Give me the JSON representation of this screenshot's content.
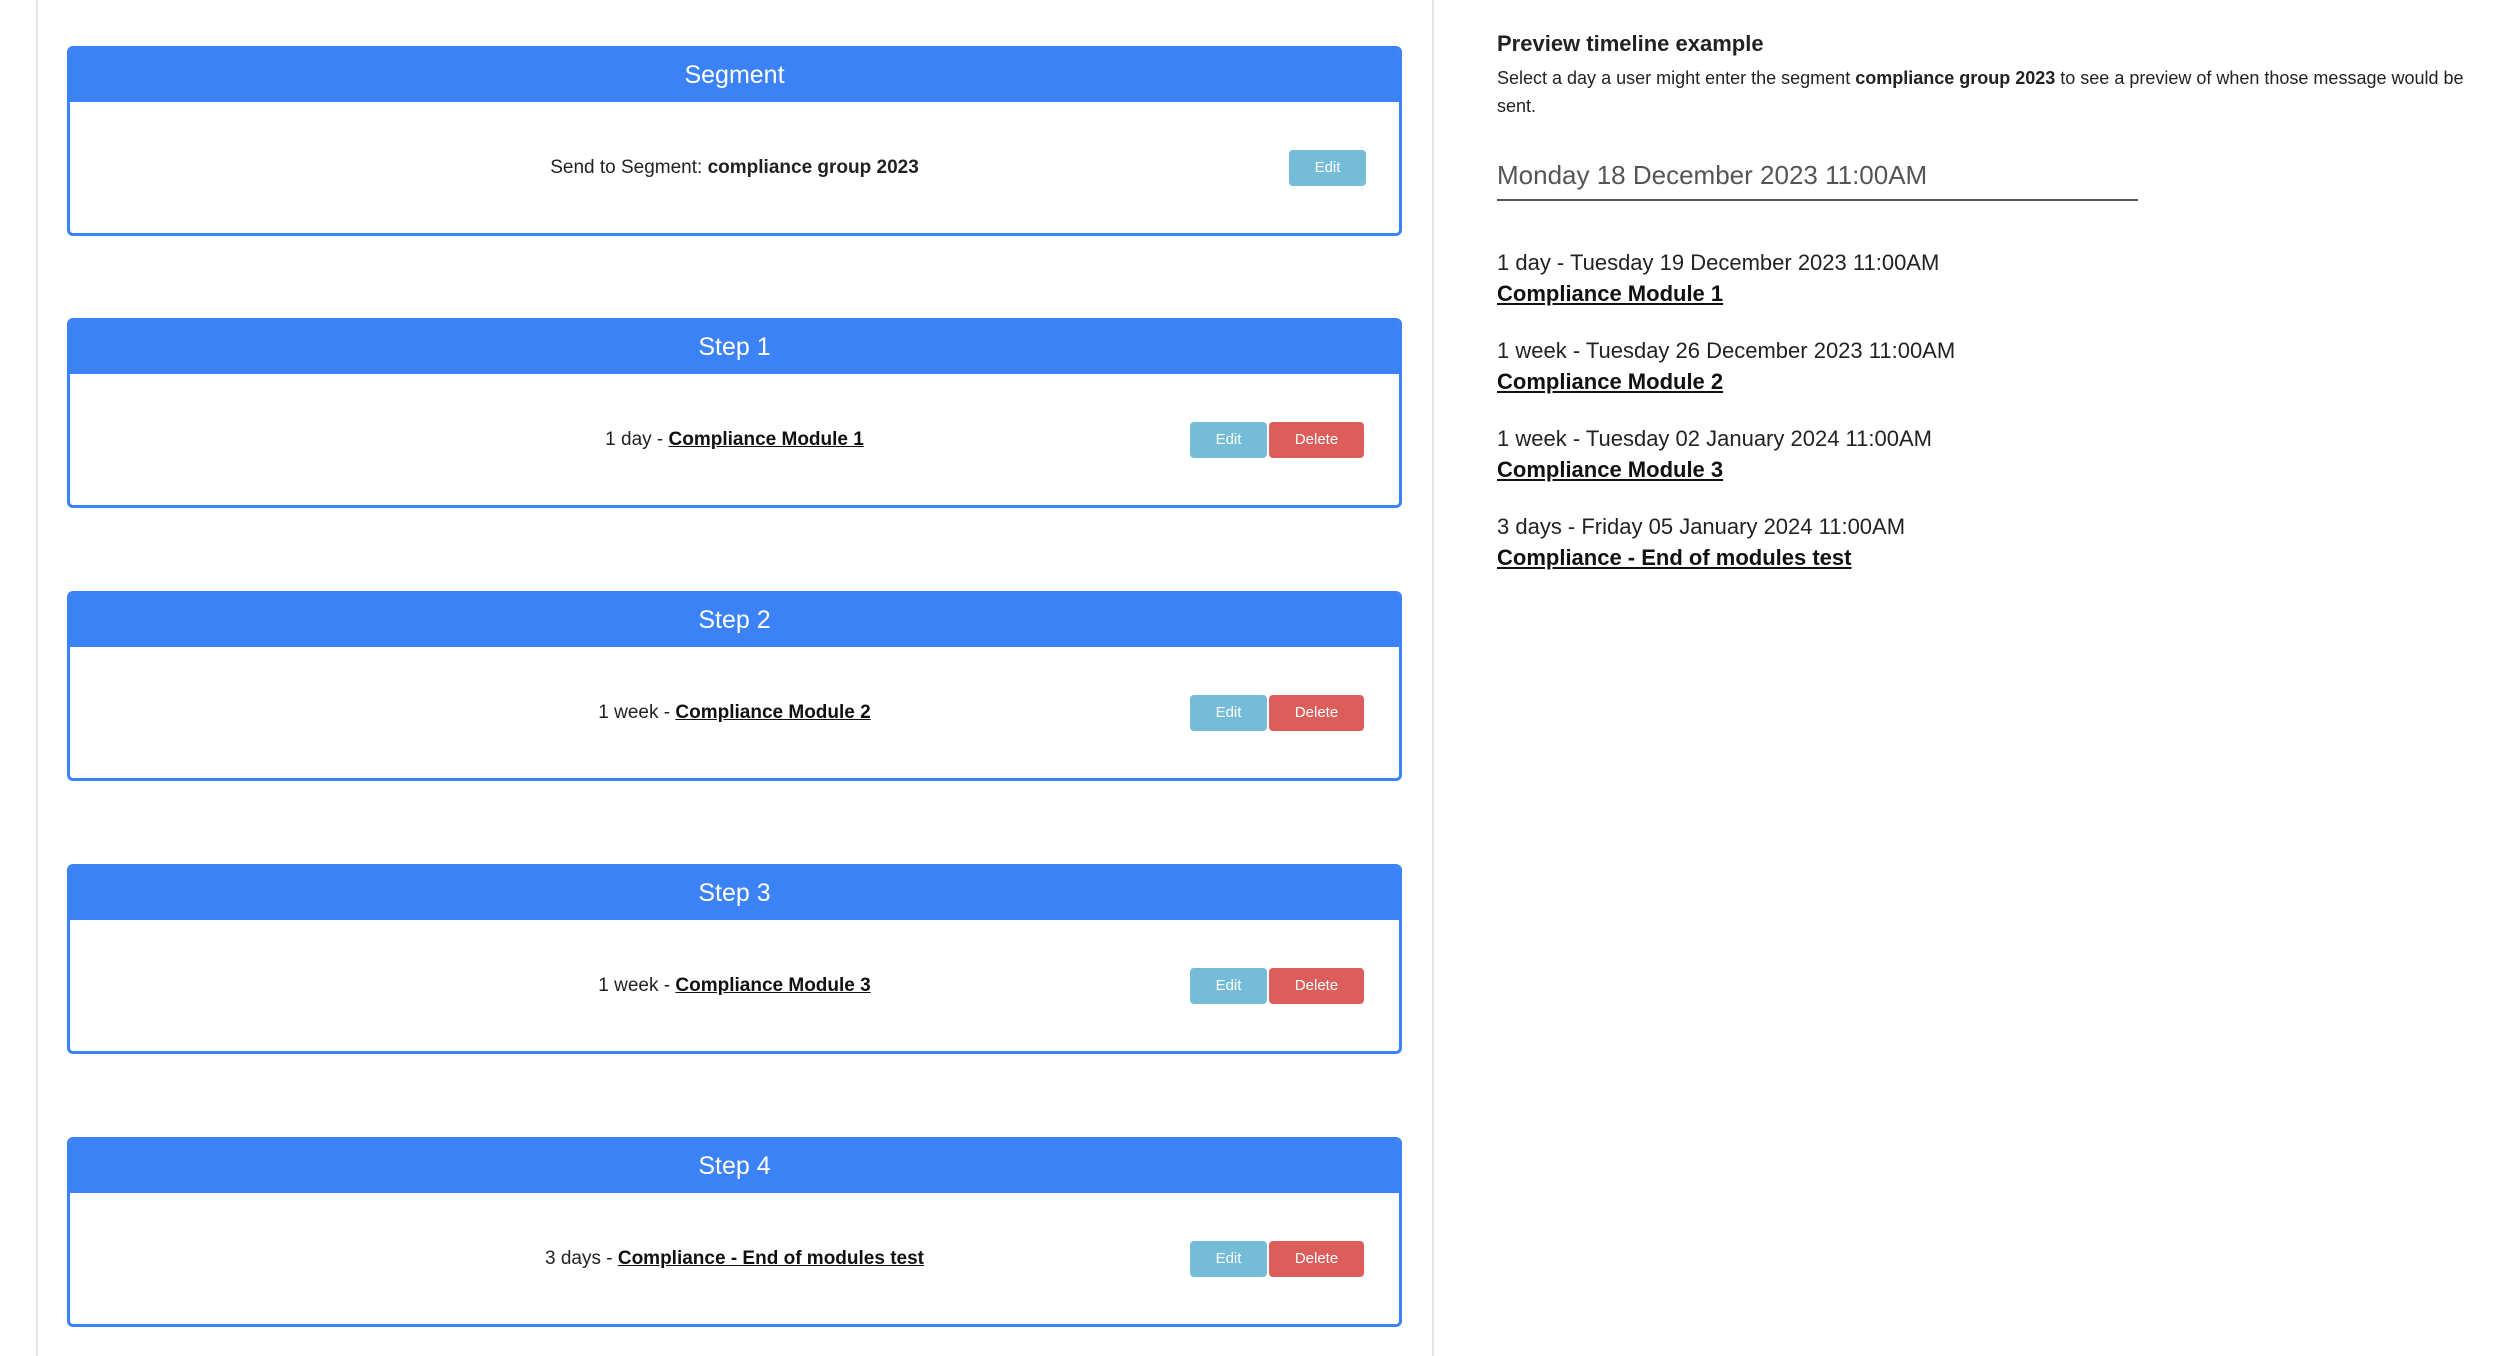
{
  "segment_card": {
    "header": "Segment",
    "text_prefix": "Send to Segment: ",
    "segment_name": "compliance group 2023",
    "edit_label": "Edit"
  },
  "steps": [
    {
      "header": "Step 1",
      "delay": "1 day - ",
      "module": "Compliance Module 1",
      "edit_label": "Edit",
      "delete_label": "Delete"
    },
    {
      "header": "Step 2",
      "delay": "1 week - ",
      "module": "Compliance Module 2",
      "edit_label": "Edit",
      "delete_label": "Delete"
    },
    {
      "header": "Step 3",
      "delay": "1 week - ",
      "module": "Compliance Module 3",
      "edit_label": "Edit",
      "delete_label": "Delete"
    },
    {
      "header": "Step 4",
      "delay": "3 days - ",
      "module": "Compliance - End of modules test",
      "edit_label": "Edit",
      "delete_label": "Delete"
    }
  ],
  "preview": {
    "title": "Preview timeline example",
    "desc_before": "Select a day a user might enter the segment ",
    "desc_segment": "compliance group 2023",
    "desc_after": " to see a preview of when those message would be sent.",
    "selected_date": "Monday 18 December 2023 11:00AM",
    "timeline": [
      {
        "when": "1 day - Tuesday 19 December 2023 11:00AM",
        "module": "Compliance Module 1"
      },
      {
        "when": "1 week - Tuesday 26 December 2023 11:00AM",
        "module": "Compliance Module 2"
      },
      {
        "when": "1 week - Tuesday 02 January 2024 11:00AM",
        "module": "Compliance Module 3"
      },
      {
        "when": "3 days - Friday 05 January 2024 11:00AM",
        "module": "Compliance - End of modules test"
      }
    ]
  },
  "colors": {
    "primary": "#3b82f6",
    "edit_button": "#74bcd8",
    "delete_button": "#dc5e5b"
  }
}
